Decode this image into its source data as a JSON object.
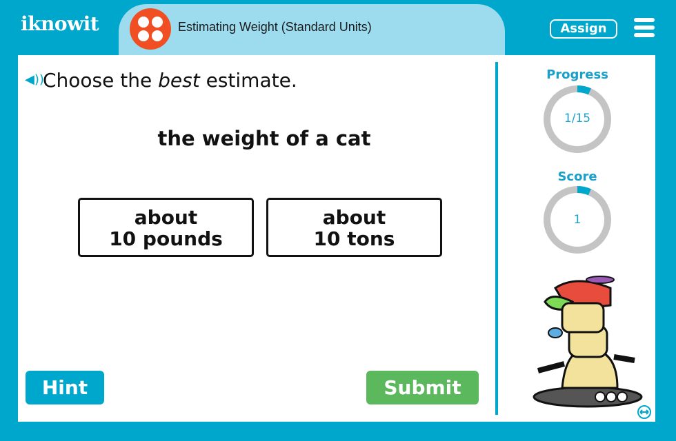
{
  "header": {
    "logo": "iknowit",
    "topic_title": "Estimating Weight (Standard Units)",
    "assign_label": "Assign",
    "topic_icon": "dice-four-icon",
    "menu_icon": "hamburger-menu-icon"
  },
  "question": {
    "instruction_prefix": "Choose the ",
    "instruction_emphasis": "best",
    "instruction_suffix": " estimate.",
    "prompt": "the weight of a cat",
    "choices": [
      {
        "line1": "about",
        "line2": "10 pounds"
      },
      {
        "line1": "about",
        "line2": "10 tons"
      }
    ]
  },
  "buttons": {
    "hint": "Hint",
    "submit": "Submit"
  },
  "stats": {
    "progress_label": "Progress",
    "progress_value": "1/15",
    "progress_fraction": 0.0667,
    "score_label": "Score",
    "score_value": "1",
    "score_fraction": 0.0667
  },
  "colors": {
    "brand": "#00a7cd",
    "title_pill": "#9ddcee",
    "topic_icon": "#f04e23",
    "submit": "#5cb85c",
    "ring_track": "#c4c4c4"
  }
}
